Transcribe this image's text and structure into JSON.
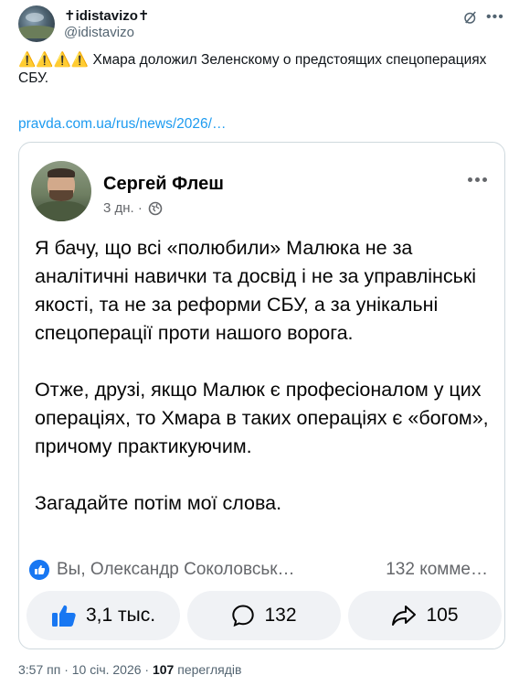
{
  "tweet": {
    "display_name": "✝idistavizo✝",
    "handle": "@idistavizo",
    "text": "⚠️⚠️⚠️⚠️ Хмара доложил Зеленскому о предстоящих спецоперациях СБУ.",
    "link": "pravda.com.ua/rus/news/2026/…",
    "icons": {
      "grok": "grok-icon",
      "more": "more-icon"
    }
  },
  "card": {
    "author": "Сергей Флеш",
    "time": "3 дн. ·",
    "paragraphs": [
      "Я бачу, що всі «полюбили» Малюка не за аналітичні навички та досвід і не за управлінські якості, та не за реформи СБУ, а за унікальні спецоперації проти нашого ворога.",
      "Отже, друзі, якщо Малюк є професіоналом у цих операціях, то Хмара в таких операціях є «богом», причому практикуючим.",
      "Загадайте потім мої слова."
    ],
    "reactions_who": "Вы, Олександр Соколовськ…",
    "comments_count_label": "132 комме…",
    "actions": {
      "like": "3,1 тыс.",
      "comment": "132",
      "share": "105"
    },
    "accent": "#1877f2"
  },
  "footer": {
    "time_date": "3:57 пп · 10 січ. 2026 ·",
    "views_count": "107",
    "views_label": "переглядів"
  }
}
